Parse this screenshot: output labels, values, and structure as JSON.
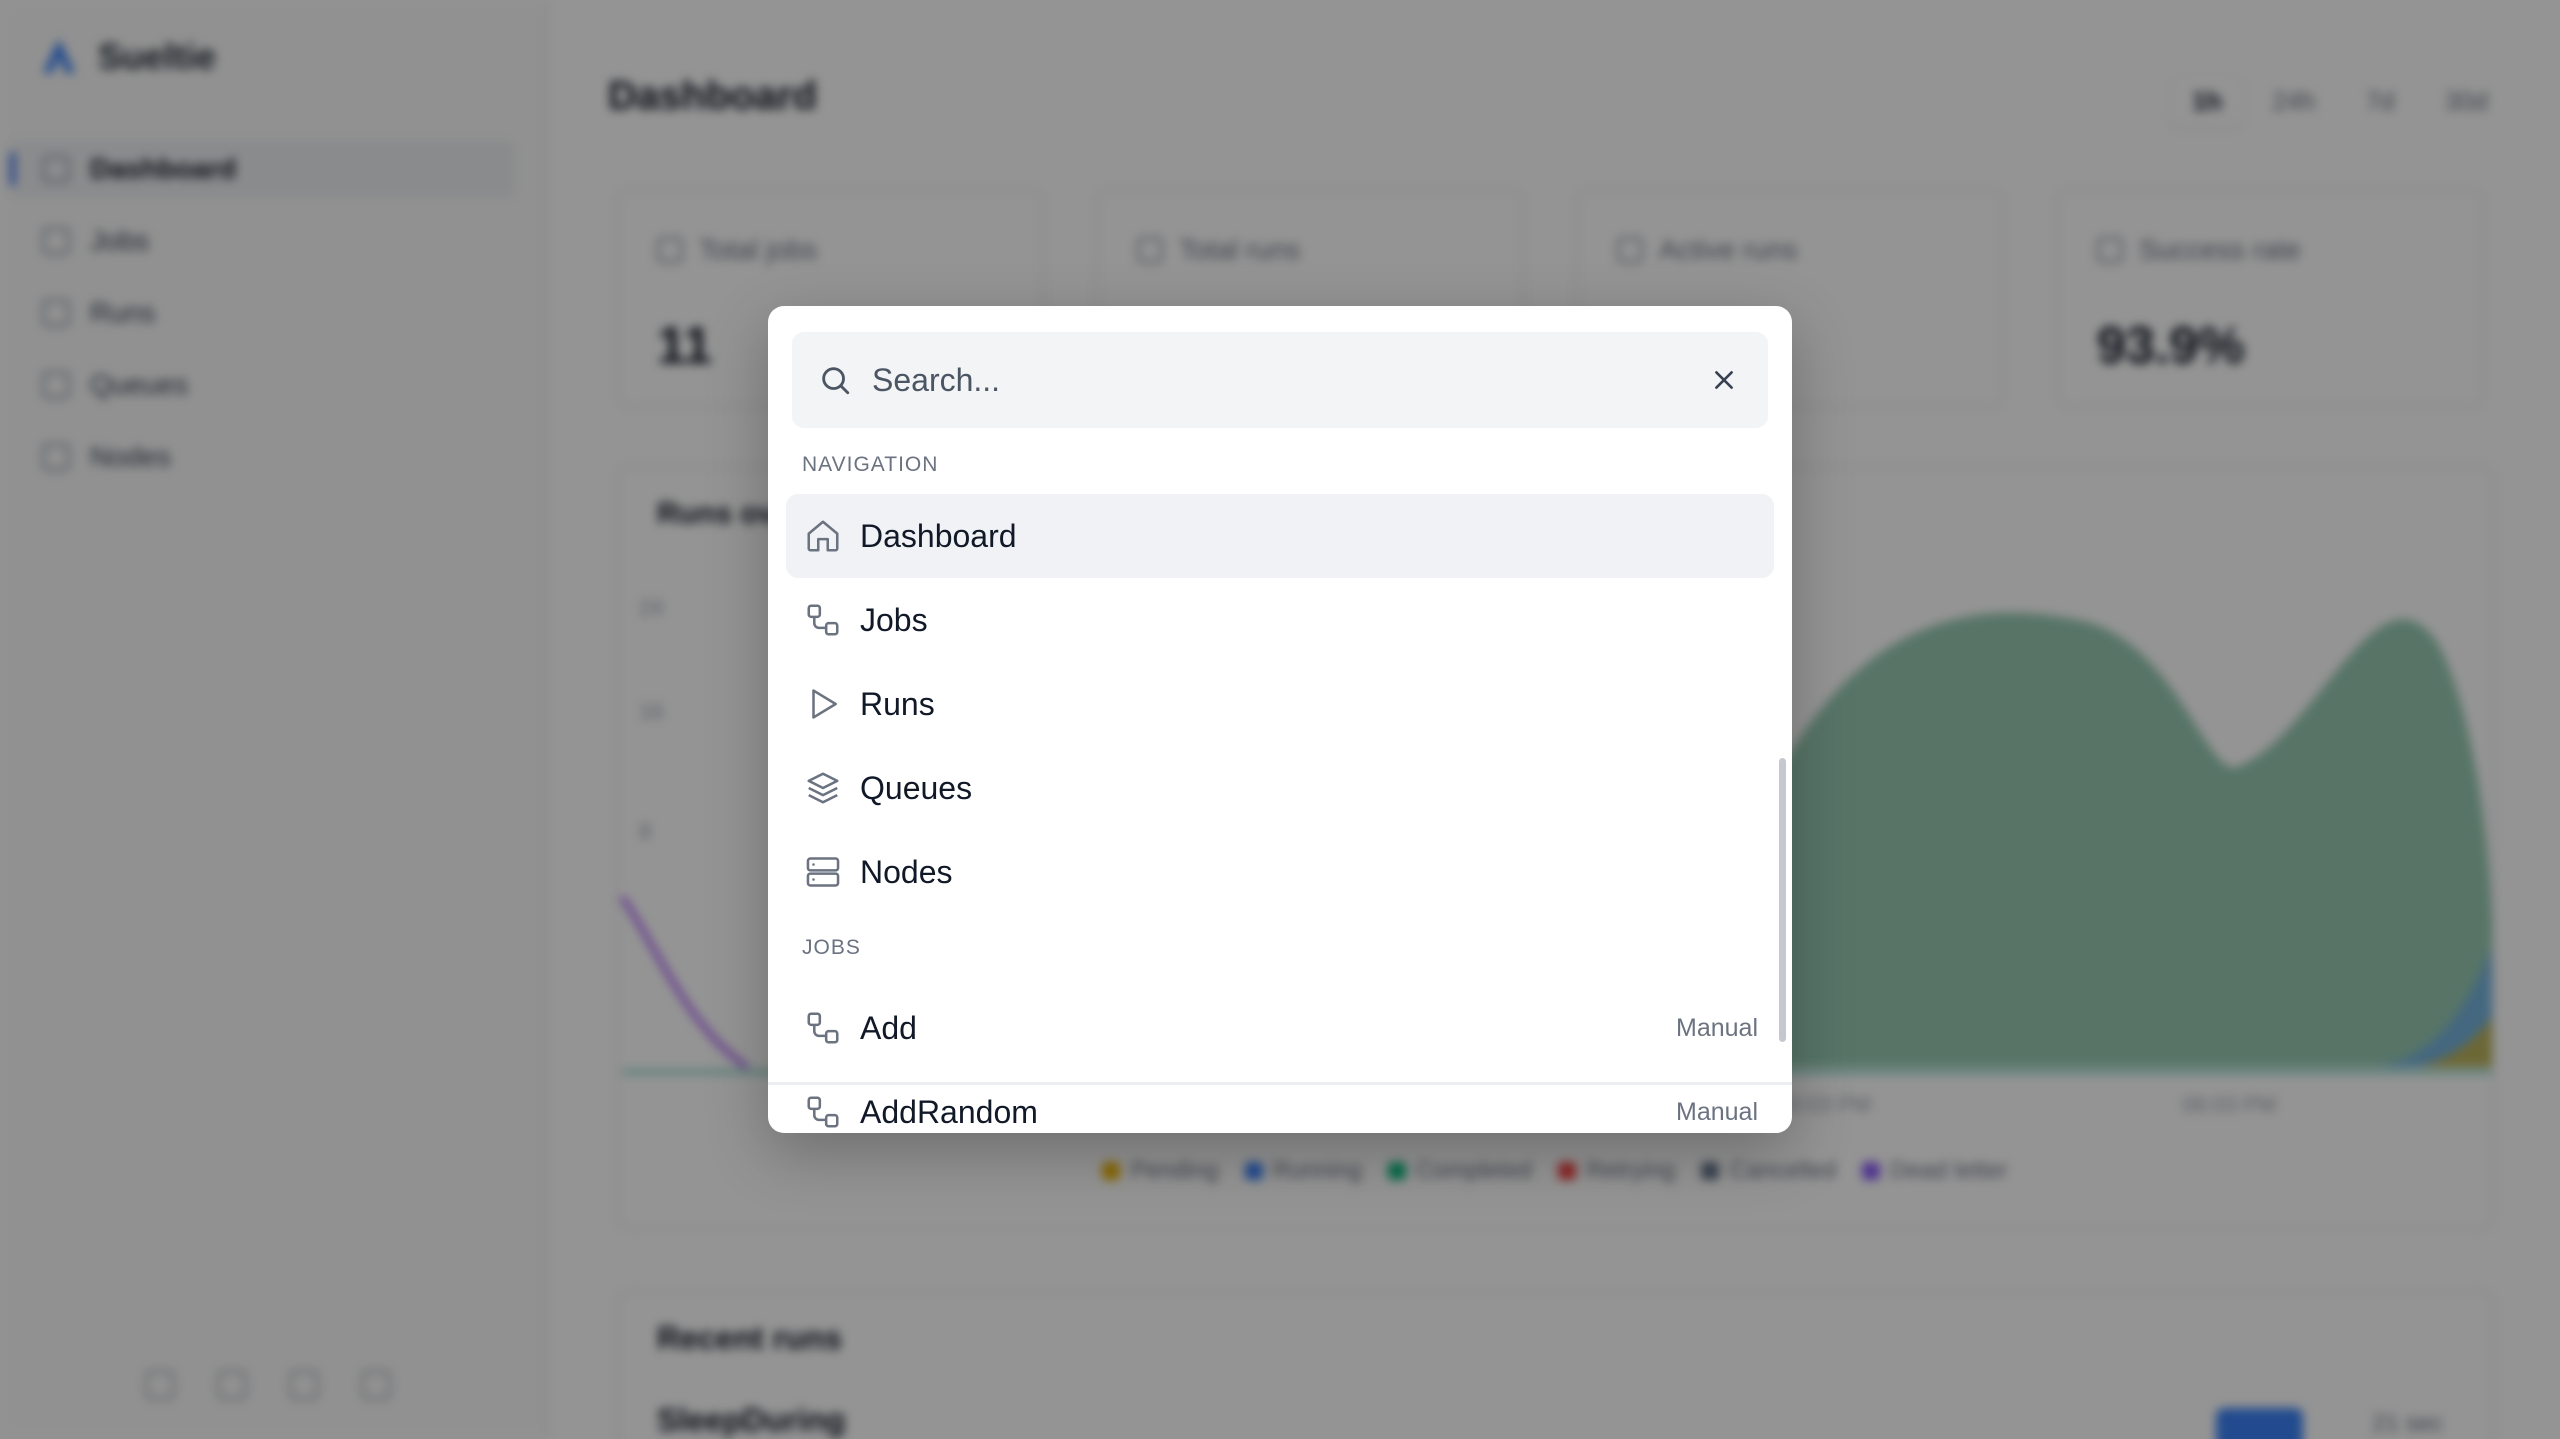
{
  "app": {
    "brand": "Sueltie"
  },
  "sidebar": {
    "items": [
      {
        "label": "Dashboard",
        "icon": "home-icon",
        "active": true
      },
      {
        "label": "Jobs",
        "icon": "workflow-icon"
      },
      {
        "label": "Runs",
        "icon": "play-icon"
      },
      {
        "label": "Queues",
        "icon": "layers-icon"
      },
      {
        "label": "Nodes",
        "icon": "server-icon"
      }
    ]
  },
  "header": {
    "title": "Dashboard",
    "range_tabs": [
      "1h",
      "24h",
      "7d",
      "30d"
    ]
  },
  "stats": [
    {
      "label": "Total jobs",
      "value": "11"
    },
    {
      "label": "Total runs",
      "value": ""
    },
    {
      "label": "Active runs",
      "value": ""
    },
    {
      "label": "Success rate",
      "value": "93.9%"
    }
  ],
  "chart": {
    "title": "Runs ov",
    "y_ticks": [
      "24",
      "16",
      "8"
    ],
    "x_ticks": [
      "03:03 PM",
      "06:03 PM"
    ],
    "legend": [
      {
        "label": "Pending",
        "color": "#eab308"
      },
      {
        "label": "Running",
        "color": "#3b82f6"
      },
      {
        "label": "Completed",
        "color": "#10b981"
      },
      {
        "label": "Retrying",
        "color": "#ef4444"
      },
      {
        "label": "Cancelled",
        "color": "#64748b"
      },
      {
        "label": "Dead letter",
        "color": "#8b5cf6"
      }
    ]
  },
  "recent": {
    "title": "Recent runs",
    "row_name": "SleepDuring",
    "row_time": "21 sec"
  },
  "palette": {
    "search_placeholder": "Search...",
    "sections": {
      "navigation": {
        "label": "NAVIGATION",
        "items": [
          {
            "label": "Dashboard",
            "icon": "home-icon"
          },
          {
            "label": "Jobs",
            "icon": "workflow-icon"
          },
          {
            "label": "Runs",
            "icon": "play-icon"
          },
          {
            "label": "Queues",
            "icon": "layers-icon"
          },
          {
            "label": "Nodes",
            "icon": "server-icon"
          }
        ]
      },
      "jobs": {
        "label": "JOBS",
        "items": [
          {
            "label": "Add",
            "meta": "Manual",
            "icon": "workflow-icon"
          },
          {
            "label": "AddRandom",
            "meta": "Manual",
            "icon": "workflow-icon"
          }
        ]
      }
    }
  }
}
